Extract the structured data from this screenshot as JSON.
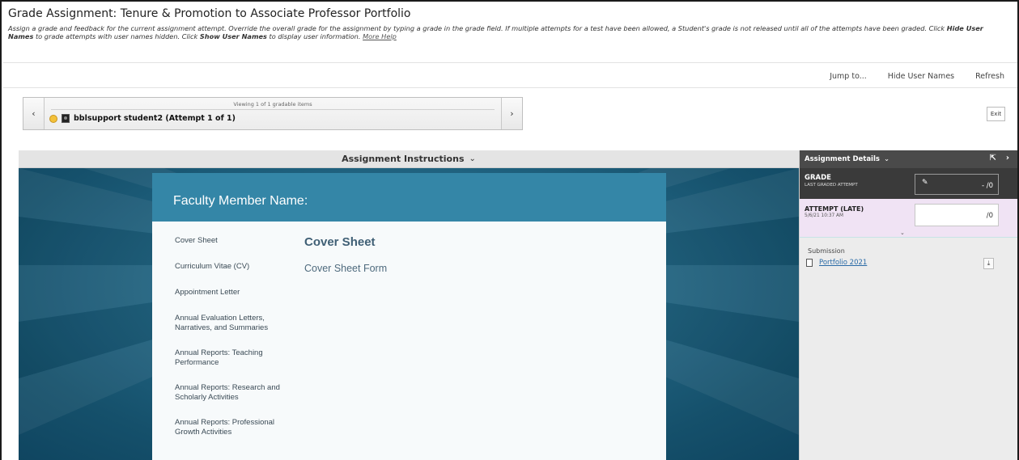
{
  "header": {
    "title": "Grade Assignment: Tenure & Promotion to Associate Professor Portfolio",
    "desc_part1": "Assign a grade and feedback for the current assignment attempt. Override the overall grade for the assignment by typing a grade in the grade field. If multiple attempts for a test have been allowed, a Student's grade is not released until all of the attempts have been graded. Click ",
    "desc_hide": "Hide User Names",
    "desc_part2": " to grade attempts with user names hidden. Click ",
    "desc_show": "Show User Names",
    "desc_part3": " to display user information. ",
    "more_help": "More Help"
  },
  "toplinks": {
    "jump": "Jump to...",
    "hide_names": "Hide User Names",
    "refresh": "Refresh"
  },
  "nav": {
    "viewing": "Viewing 1 of 1 gradable items",
    "student": "bblsupport student2 (Attempt 1 of 1)",
    "prev_icon": "chevron-left-icon",
    "next_icon": "chevron-right-icon"
  },
  "exit_label": "Exit",
  "instructions": {
    "label": "Assignment Instructions"
  },
  "card": {
    "heading": "Faculty Member Name:",
    "toc": [
      "Cover Sheet",
      "Curriculum Vitae (CV)",
      "Appointment Letter",
      "Annual Evaluation Letters, Narratives, and Summaries",
      "Annual Reports: Teaching Performance",
      "Annual Reports: Research and Scholarly Activities",
      "Annual Reports: Professional Growth Activities"
    ],
    "content_title": "Cover Sheet",
    "content_sub": "Cover Sheet Form"
  },
  "side": {
    "header": "Assignment Details",
    "grade_label": "GRADE",
    "grade_sub": "LAST GRADED ATTEMPT",
    "grade_value": "- /0",
    "attempt_label": "ATTEMPT (LATE)",
    "attempt_date": "5/6/21 10:37 AM",
    "attempt_value": "/0",
    "submission_label": "Submission",
    "file_name": "Portfolio 2021"
  },
  "colors": {
    "accent": "#3486a7",
    "side_dark": "#3a3a3a",
    "attempt_bg": "#f0e3f4",
    "link": "#2a6aa6"
  }
}
